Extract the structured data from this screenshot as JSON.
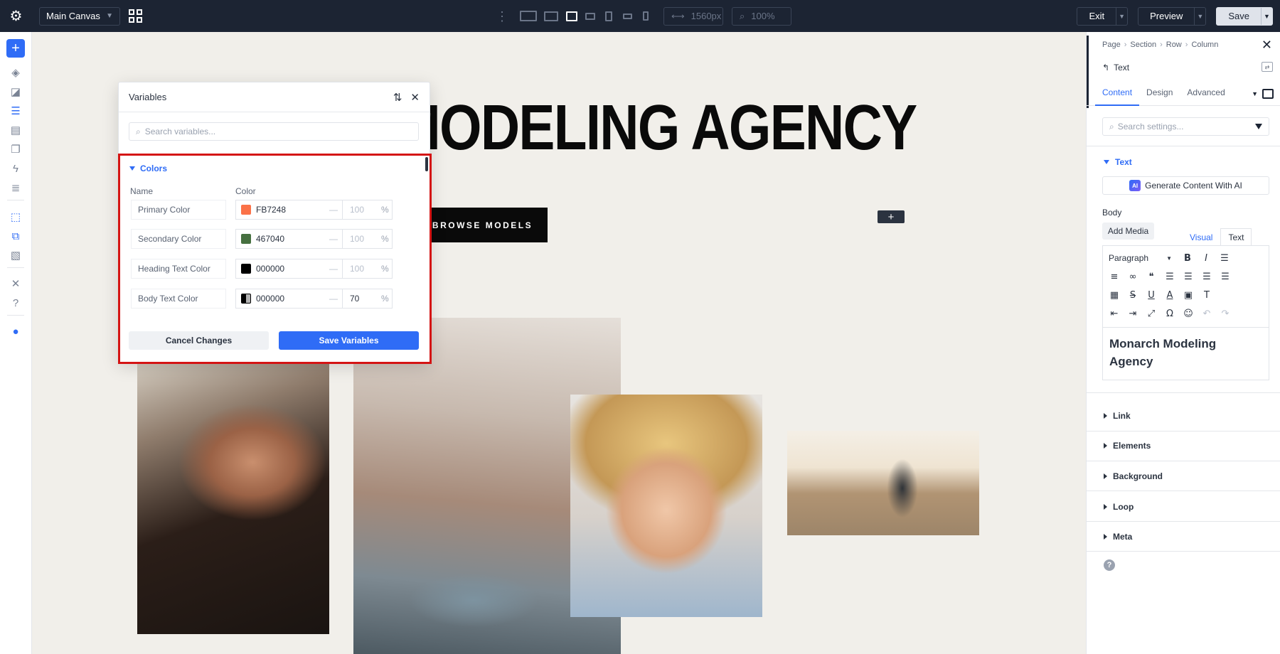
{
  "topbar": {
    "canvas_label": "Main Canvas",
    "width_value": "1560px",
    "zoom_value": "100%",
    "exit_label": "Exit",
    "preview_label": "Preview",
    "save_label": "Save"
  },
  "canvas": {
    "hero_text": "MODELING AGENCY",
    "button_label": "BROWSE MODELS",
    "add_symbol": "+"
  },
  "variables_panel": {
    "title": "Variables",
    "search_placeholder": "Search variables...",
    "section_title": "Colors",
    "col_name": "Name",
    "col_color": "Color",
    "rows": [
      {
        "name": "Primary Color",
        "hex": "FB7248",
        "swatch": "#FB7248",
        "opacity": "100",
        "opacity_set": false
      },
      {
        "name": "Secondary Color",
        "hex": "467040",
        "swatch": "#467040",
        "opacity": "100",
        "opacity_set": false
      },
      {
        "name": "Heading Text Color",
        "hex": "000000",
        "swatch": "#000000",
        "opacity": "100",
        "opacity_set": false
      },
      {
        "name": "Body Text Color",
        "hex": "000000",
        "swatch": "#000000",
        "opacity": "70",
        "opacity_set": true
      }
    ],
    "dash": "—",
    "pct": "%",
    "cancel_label": "Cancel Changes",
    "save_label": "Save Variables"
  },
  "settings_panel": {
    "breadcrumb": [
      "Page",
      "Section",
      "Row",
      "Column"
    ],
    "crumb_sep": "›",
    "module_name": "Text",
    "tabs": [
      "Content",
      "Design",
      "Advanced"
    ],
    "search_placeholder": "Search settings...",
    "text_group": "Text",
    "ai_badge": "AI",
    "ai_label": "Generate Content With AI",
    "body_label": "Body",
    "add_media": "Add Media",
    "visual_tab": "Visual",
    "text_tab": "Text",
    "paragraph": "Paragraph",
    "content": "Monarch Modeling Agency",
    "groups": [
      "Link",
      "Elements",
      "Background",
      "Loop",
      "Meta"
    ]
  },
  "colors": {
    "accent": "#2f6cf6",
    "topbar": "#1c2433",
    "highlight": "#d41414"
  }
}
